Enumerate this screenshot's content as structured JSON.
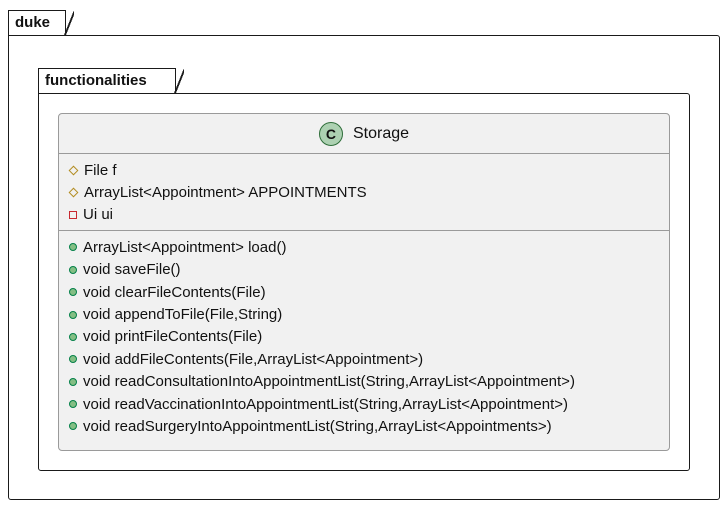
{
  "packages": {
    "outer": {
      "name": "duke"
    },
    "inner": {
      "name": "functionalities"
    }
  },
  "class": {
    "badge": "C",
    "name": "Storage",
    "badge_color": "#add1b2",
    "fields": [
      {
        "visibility": "protected",
        "text": "File f"
      },
      {
        "visibility": "protected",
        "text": "ArrayList<Appointment> APPOINTMENTS"
      },
      {
        "visibility": "private",
        "text": "Ui ui"
      }
    ],
    "methods": [
      {
        "visibility": "public",
        "text": "ArrayList<Appointment> load()"
      },
      {
        "visibility": "public",
        "text": "void saveFile()"
      },
      {
        "visibility": "public",
        "text": "void clearFileContents(File)"
      },
      {
        "visibility": "public",
        "text": "void appendToFile(File,String)"
      },
      {
        "visibility": "public",
        "text": "void printFileContents(File)"
      },
      {
        "visibility": "public",
        "text": "void addFileContents(File,ArrayList<Appointment>)"
      },
      {
        "visibility": "public",
        "text": "void readConsultationIntoAppointmentList(String,ArrayList<Appointment>)"
      },
      {
        "visibility": "public",
        "text": "void readVaccinationIntoAppointmentList(String,ArrayList<Appointment>)"
      },
      {
        "visibility": "public",
        "text": "void readSurgeryIntoAppointmentList(String,ArrayList<Appointments>)"
      }
    ]
  },
  "colors": {
    "protected": "#b38d22",
    "private": "#c82930",
    "public": "#84be84"
  }
}
